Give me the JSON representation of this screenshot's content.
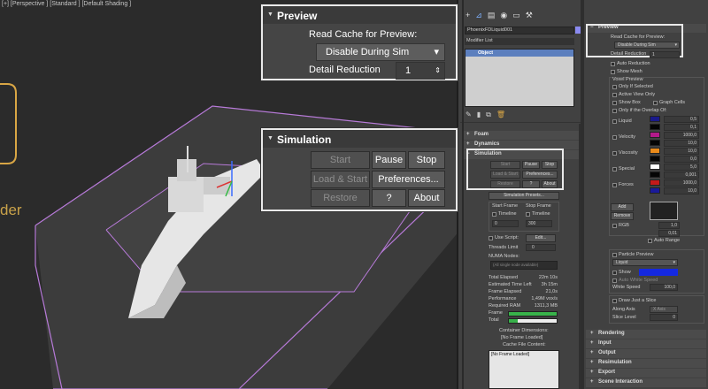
{
  "viewport": {
    "label": "[+] [Perspective ] [Standard ] [Default Shading ]",
    "logo_fragment": "der"
  },
  "preview_callout": {
    "title": "Preview",
    "read_cache_label": "Read Cache for Preview:",
    "read_cache_value": "Disable During Sim",
    "detail_label": "Detail Reduction",
    "detail_value": "1"
  },
  "simulation_callout": {
    "title": "Simulation",
    "buttons": {
      "start": "Start",
      "pause": "Pause",
      "stop": "Stop",
      "load_start": "Load & Start",
      "preferences": "Preferences...",
      "restore": "Restore",
      "help": "?",
      "about": "About"
    }
  },
  "command_panel": {
    "object_name": "PhoenixFDLiquid001",
    "modifier_list": "Modifier List",
    "stack_item": "Object",
    "rollouts": {
      "foam": "Foam",
      "dynamics": "Dynamics",
      "simulation": "Simulation"
    },
    "sim": {
      "start": "Start",
      "pause": "Pause",
      "stop": "Stop",
      "load_start": "Load & Start",
      "preferences": "Preferences...",
      "restore": "Restore",
      "help": "?",
      "about": "About",
      "presets": "Simulation Presets...",
      "start_frame": "Start Frame",
      "stop_frame": "Stop Frame",
      "timeline": "Timeline",
      "start_value": "0",
      "stop_value": "300",
      "use_script": "Use Script:",
      "edit": "Edit...",
      "threads_limit": "Threads Limit",
      "threads_value": "0",
      "numa": "NUMA Nodes:",
      "numa_placeholder": "(All single node available)",
      "stats": [
        {
          "label": "Total Elapsed",
          "value": "22m 10s"
        },
        {
          "label": "Estimated Time Left",
          "value": "3h 15m"
        },
        {
          "label": "Frame Elapsed",
          "value": "21,0s"
        },
        {
          "label": "Performance",
          "value": "1,49M vox/s"
        },
        {
          "label": "Required RAM",
          "value": "1311,3 MB"
        }
      ],
      "frame_label": "Frame",
      "total_label": "Total",
      "container_dims": "Container Dimensions:",
      "no_frame": "[No Frame Loaded]",
      "cache_contents": "Cache File Content:",
      "cache_box": "[No Frame Loaded]"
    }
  },
  "params": {
    "preview_title": "Preview",
    "read_cache_label": "Read Cache for Preview:",
    "read_cache_value": "Disable During Sim",
    "detail_label": "Detail Reduction",
    "detail_value": "1",
    "auto_reduction": "Auto Reduction",
    "show_mesh": "Show Mesh",
    "voxel_preview": "Voxel Preview",
    "only_if_selected": "Only If Selected",
    "active_view_only": "Active View Only",
    "show_box": "Show Box",
    "graph_cells": "Graph Cells",
    "only_overlap": "Only if the Overlap Of:",
    "channels": [
      {
        "name": "Liquid",
        "v1": "0,5",
        "v2": "0,1"
      },
      {
        "name": "Velocity",
        "v1": "1000,0",
        "v2": "10,0"
      },
      {
        "name": "Viscosity",
        "v1": "10,0",
        "v2": "0,0"
      },
      {
        "name": "Special",
        "v1": "5,0",
        "v2": "0,001"
      },
      {
        "name": "Forces",
        "v1": "1000,0",
        "v2": "10,0"
      }
    ],
    "add": "Add",
    "remove": "Remove",
    "rgb": "RGB",
    "rgb_v1": "1,0",
    "rgb_v2": "0,01",
    "auto_range": "Auto Range",
    "particle_preview": "Particle Preview",
    "particle_type": "Liquid",
    "show": "Show",
    "auto_white_speed": "Auto White Speed",
    "white_speed": "White Speed",
    "white_speed_value": "100,0",
    "draw_slice": "Draw Just a Slice",
    "along_axis": "Along Axis",
    "along_axis_value": "X Axis",
    "slice_level": "Slice Level",
    "slice_value": "0",
    "rollouts": [
      "Rendering",
      "Input",
      "Output",
      "Resimulation",
      "Export",
      "Scene Interaction"
    ]
  },
  "colors": {
    "accent_blue": "#2244cc",
    "selection": "#5c7fbe",
    "progress_green": "#38b24a"
  }
}
